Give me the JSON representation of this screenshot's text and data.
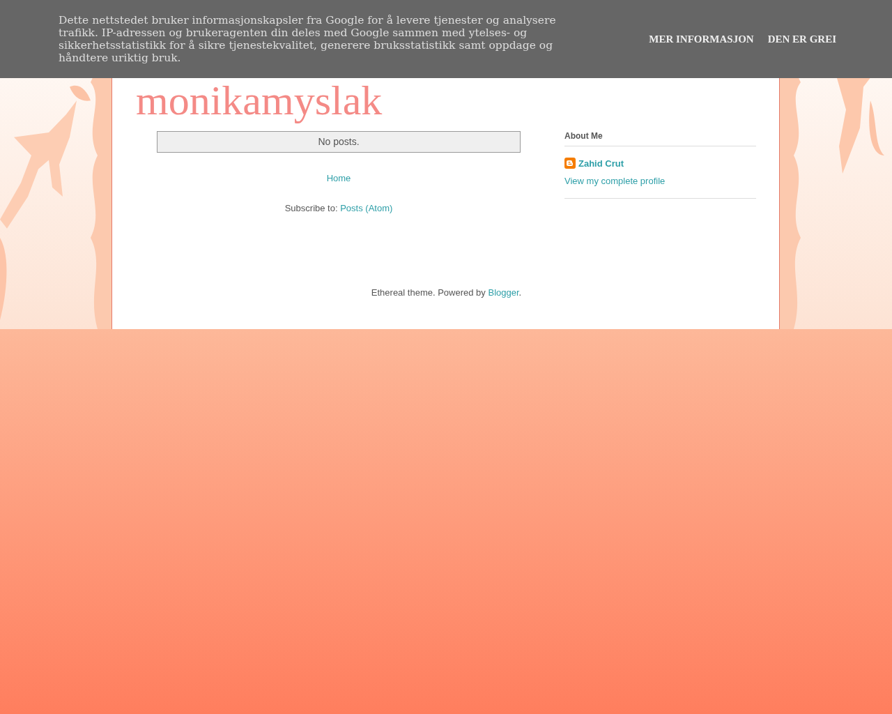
{
  "cookie_bar": {
    "message": "Dette nettstedet bruker informasjonskapsler fra Google for å levere tjenester og analysere trafikk. IP-adressen og brukeragenten din deles med Google sammen med ytelses- og sikkerhetsstatistikk for å sikre tjenestekvalitet, generere bruksstatistikk samt oppdage og håndtere uriktig bruk.",
    "buttons": [
      "MER INFORMASJON",
      "DEN ER GREI"
    ]
  },
  "blog": {
    "title": "monikamyslak"
  },
  "main": {
    "empty_message": "No posts.",
    "home_link": "Home",
    "subscribe_label": "Subscribe to:",
    "subscribe_link": "Posts (Atom)"
  },
  "sidebar": {
    "heading": "About Me",
    "profile_name": "Zahid Crut",
    "profile_link": "View my complete profile"
  },
  "footer": {
    "text": "Ethereal theme. Powered by",
    "link": "Blogger",
    "end": "."
  }
}
